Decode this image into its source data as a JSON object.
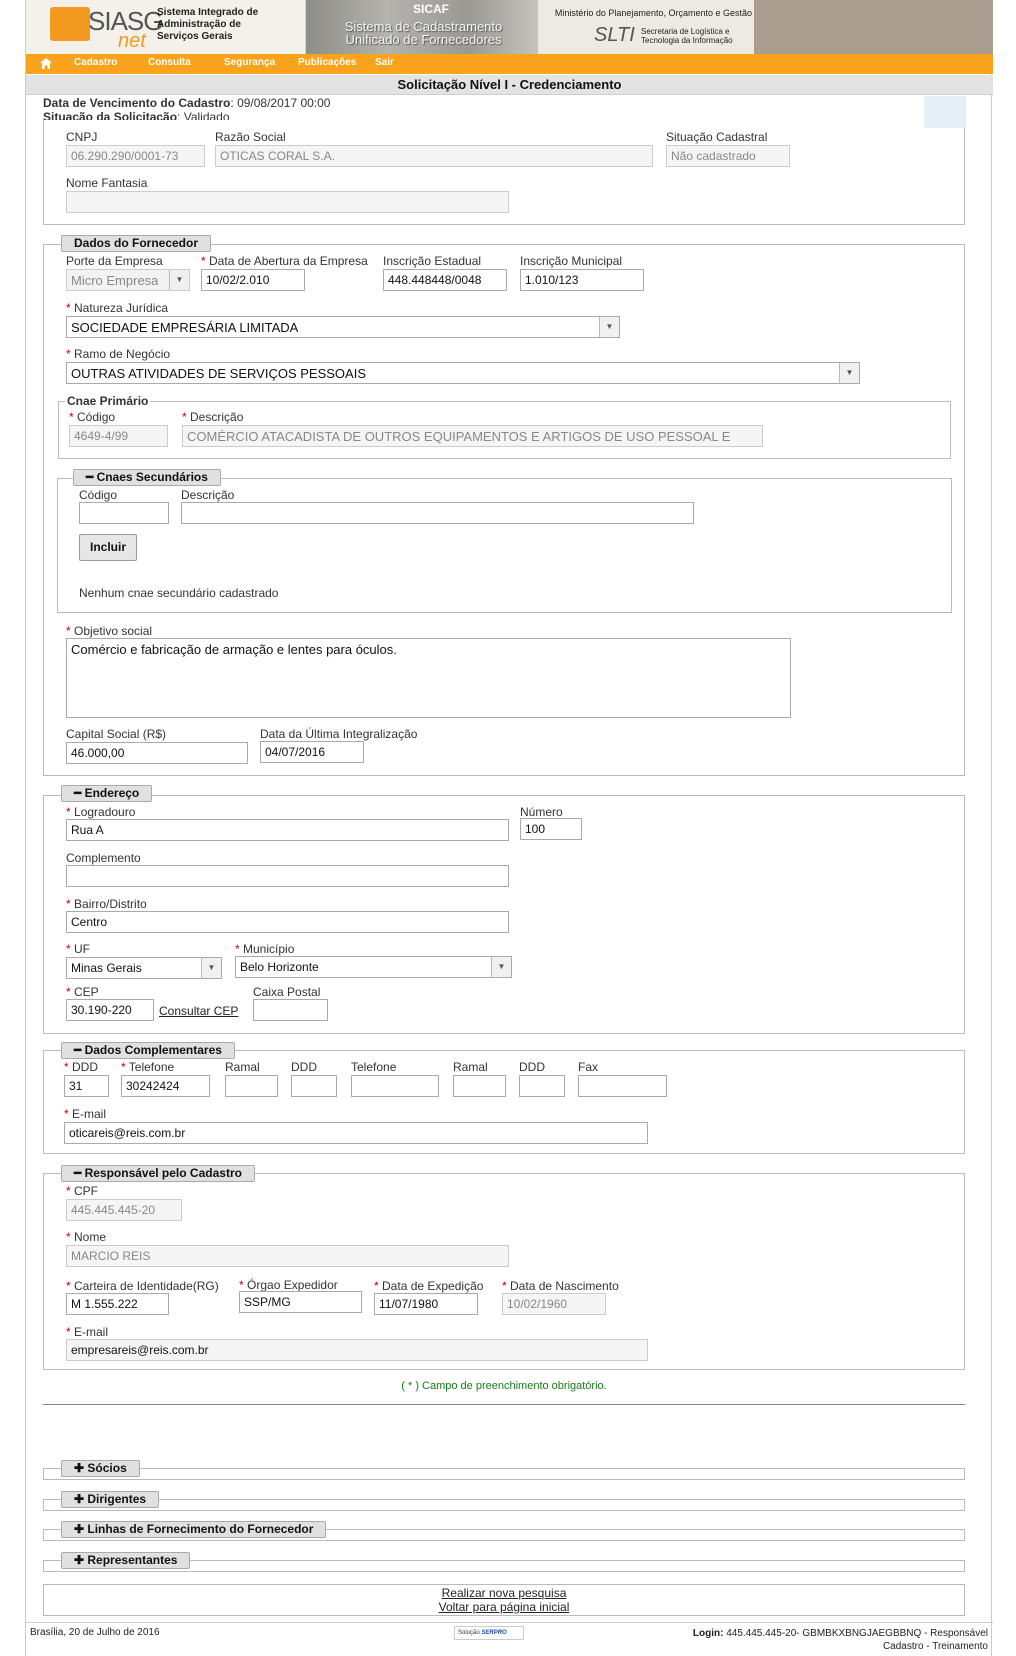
{
  "header": {
    "logo_text": "SIASG",
    "logo_suffix": "net",
    "system_name": "Sistema Integrado de Administração de Serviços Gerais",
    "app_title": "SICAF",
    "app_subtitle": "Sistema de Cadastramento Unificado de Fornecedores",
    "ministry": "Ministério do Planejamento, Orçamento e Gestão",
    "slti": "SLTI",
    "slti_sub": "Secretaria de Logística e Tecnologia da Informação"
  },
  "nav": [
    "Cadastro",
    "Consulta",
    "Segurança",
    "Publicações",
    "Sair"
  ],
  "page_title": "Solicitação Nível I - Credenciamento",
  "info": {
    "venc_label": "Data de Vencimento do Cadastro",
    "venc_value": "09/08/2017 00:00",
    "sit_label": "Situação da Solicitação",
    "sit_value": "Validado"
  },
  "top": {
    "cnpj_label": "CNPJ",
    "cnpj": "06.290.290/0001-73",
    "razao_label": "Razão Social",
    "razao": "OTICAS CORAL S.A.",
    "situacao_label": "Situação Cadastral",
    "situacao": "Não cadastrado",
    "fantasia_label": "Nome Fantasia",
    "fantasia": ""
  },
  "fornecedor": {
    "legend": "Dados do Fornecedor",
    "porte_label": "Porte da Empresa",
    "porte": "Micro Empresa",
    "abertura_label": "Data de Abertura da Empresa",
    "abertura": "10/02/2.010",
    "ie_label": "Inscrição Estadual",
    "ie": "448.448448/0048",
    "im_label": "Inscrição Municipal",
    "im": "1.010/123",
    "natureza_label": "Natureza Jurídica",
    "natureza": "SOCIEDADE EMPRESÁRIA LIMITADA",
    "ramo_label": "Ramo de Negócio",
    "ramo": "OUTRAS ATIVIDADES DE SERVIÇOS PESSOAIS",
    "cnae_legend": "Cnae Primário",
    "cnae_cod_label": "Código",
    "cnae_cod": "4649-4/99",
    "cnae_desc_label": "Descrição",
    "cnae_desc": "COMÉRCIO ATACADISTA DE OUTROS EQUIPAMENTOS E ARTIGOS DE USO PESSOAL E",
    "sec_legend": "Cnaes Secundários",
    "sec_cod_label": "Código",
    "sec_desc_label": "Descrição",
    "incluir": "Incluir",
    "nenhum": "Nenhum cnae secundário cadastrado",
    "objetivo_label": "Objetivo social",
    "objetivo": "Comércio e fabricação de armação e lentes para óculos.",
    "capital_label": "Capital Social (R$)",
    "capital": "46.000,00",
    "integralizacao_label": "Data da Última Integralização",
    "integralizacao": "04/07/2016"
  },
  "endereco": {
    "legend": "Endereço",
    "logradouro_label": "Logradouro",
    "logradouro": "Rua A",
    "numero_label": "Número",
    "numero": "100",
    "complemento_label": "Complemento",
    "complemento": "",
    "bairro_label": "Bairro/Distrito",
    "bairro": "Centro",
    "uf_label": "UF",
    "uf": "Minas Gerais",
    "municipio_label": "Município",
    "municipio": "Belo Horizonte",
    "cep_label": "CEP",
    "cep": "30.190-220",
    "consultar_cep": "Consultar CEP",
    "caixa_label": "Caixa Postal",
    "caixa": ""
  },
  "complementares": {
    "legend": "Dados Complementares",
    "ddd_label": "DDD",
    "ddd": "31",
    "tel_label": "Telefone",
    "tel": "30242424",
    "ramal_label": "Ramal",
    "ddd2_label": "DDD",
    "tel2_label": "Telefone",
    "ramal2_label": "Ramal",
    "ddd3_label": "DDD",
    "fax_label": "Fax",
    "email_label": "E-mail",
    "email": "oticareis@reis.com.br"
  },
  "responsavel": {
    "legend": "Responsável pelo Cadastro",
    "cpf_label": "CPF",
    "cpf": "445.445.445-20",
    "nome_label": "Nome",
    "nome": "MARCIO REIS",
    "rg_label": "Carteira de Identidade(RG)",
    "rg": "M 1.555.222",
    "orgao_label": "Órgao Expedidor",
    "orgao": "SSP/MG",
    "expedicao_label": "Data de Expedição",
    "expedicao": "11/07/1980",
    "nascimento_label": "Data de Nascimento",
    "nascimento": "10/02/1960",
    "email_label": "E-mail",
    "email": "empresareis@reis.com.br"
  },
  "obrigatorio_note": "( * ) Campo de preenchimento obrigatório.",
  "sections": [
    "Sócios",
    "Dirigentes",
    "Linhas de Fornecimento do Fornecedor",
    "Representantes"
  ],
  "links": {
    "nova_pesquisa": "Realizar nova pesquisa",
    "voltar": "Voltar para página inicial"
  },
  "footer": {
    "date": "Brasília, 20 de Julho de 2016",
    "serpro_prefix": "Solução",
    "serpro": "SERPRO",
    "login_label": "Login:",
    "login_value": "445.445.445-20- GBMBKXBNGJAEGBBNQ - Responsável",
    "login_line2": "Cadastro - Treinamento"
  },
  "colors": {
    "nav_orange": "#f8a31b",
    "required_red": "#cc0000",
    "note_green": "#1a7a1a"
  }
}
